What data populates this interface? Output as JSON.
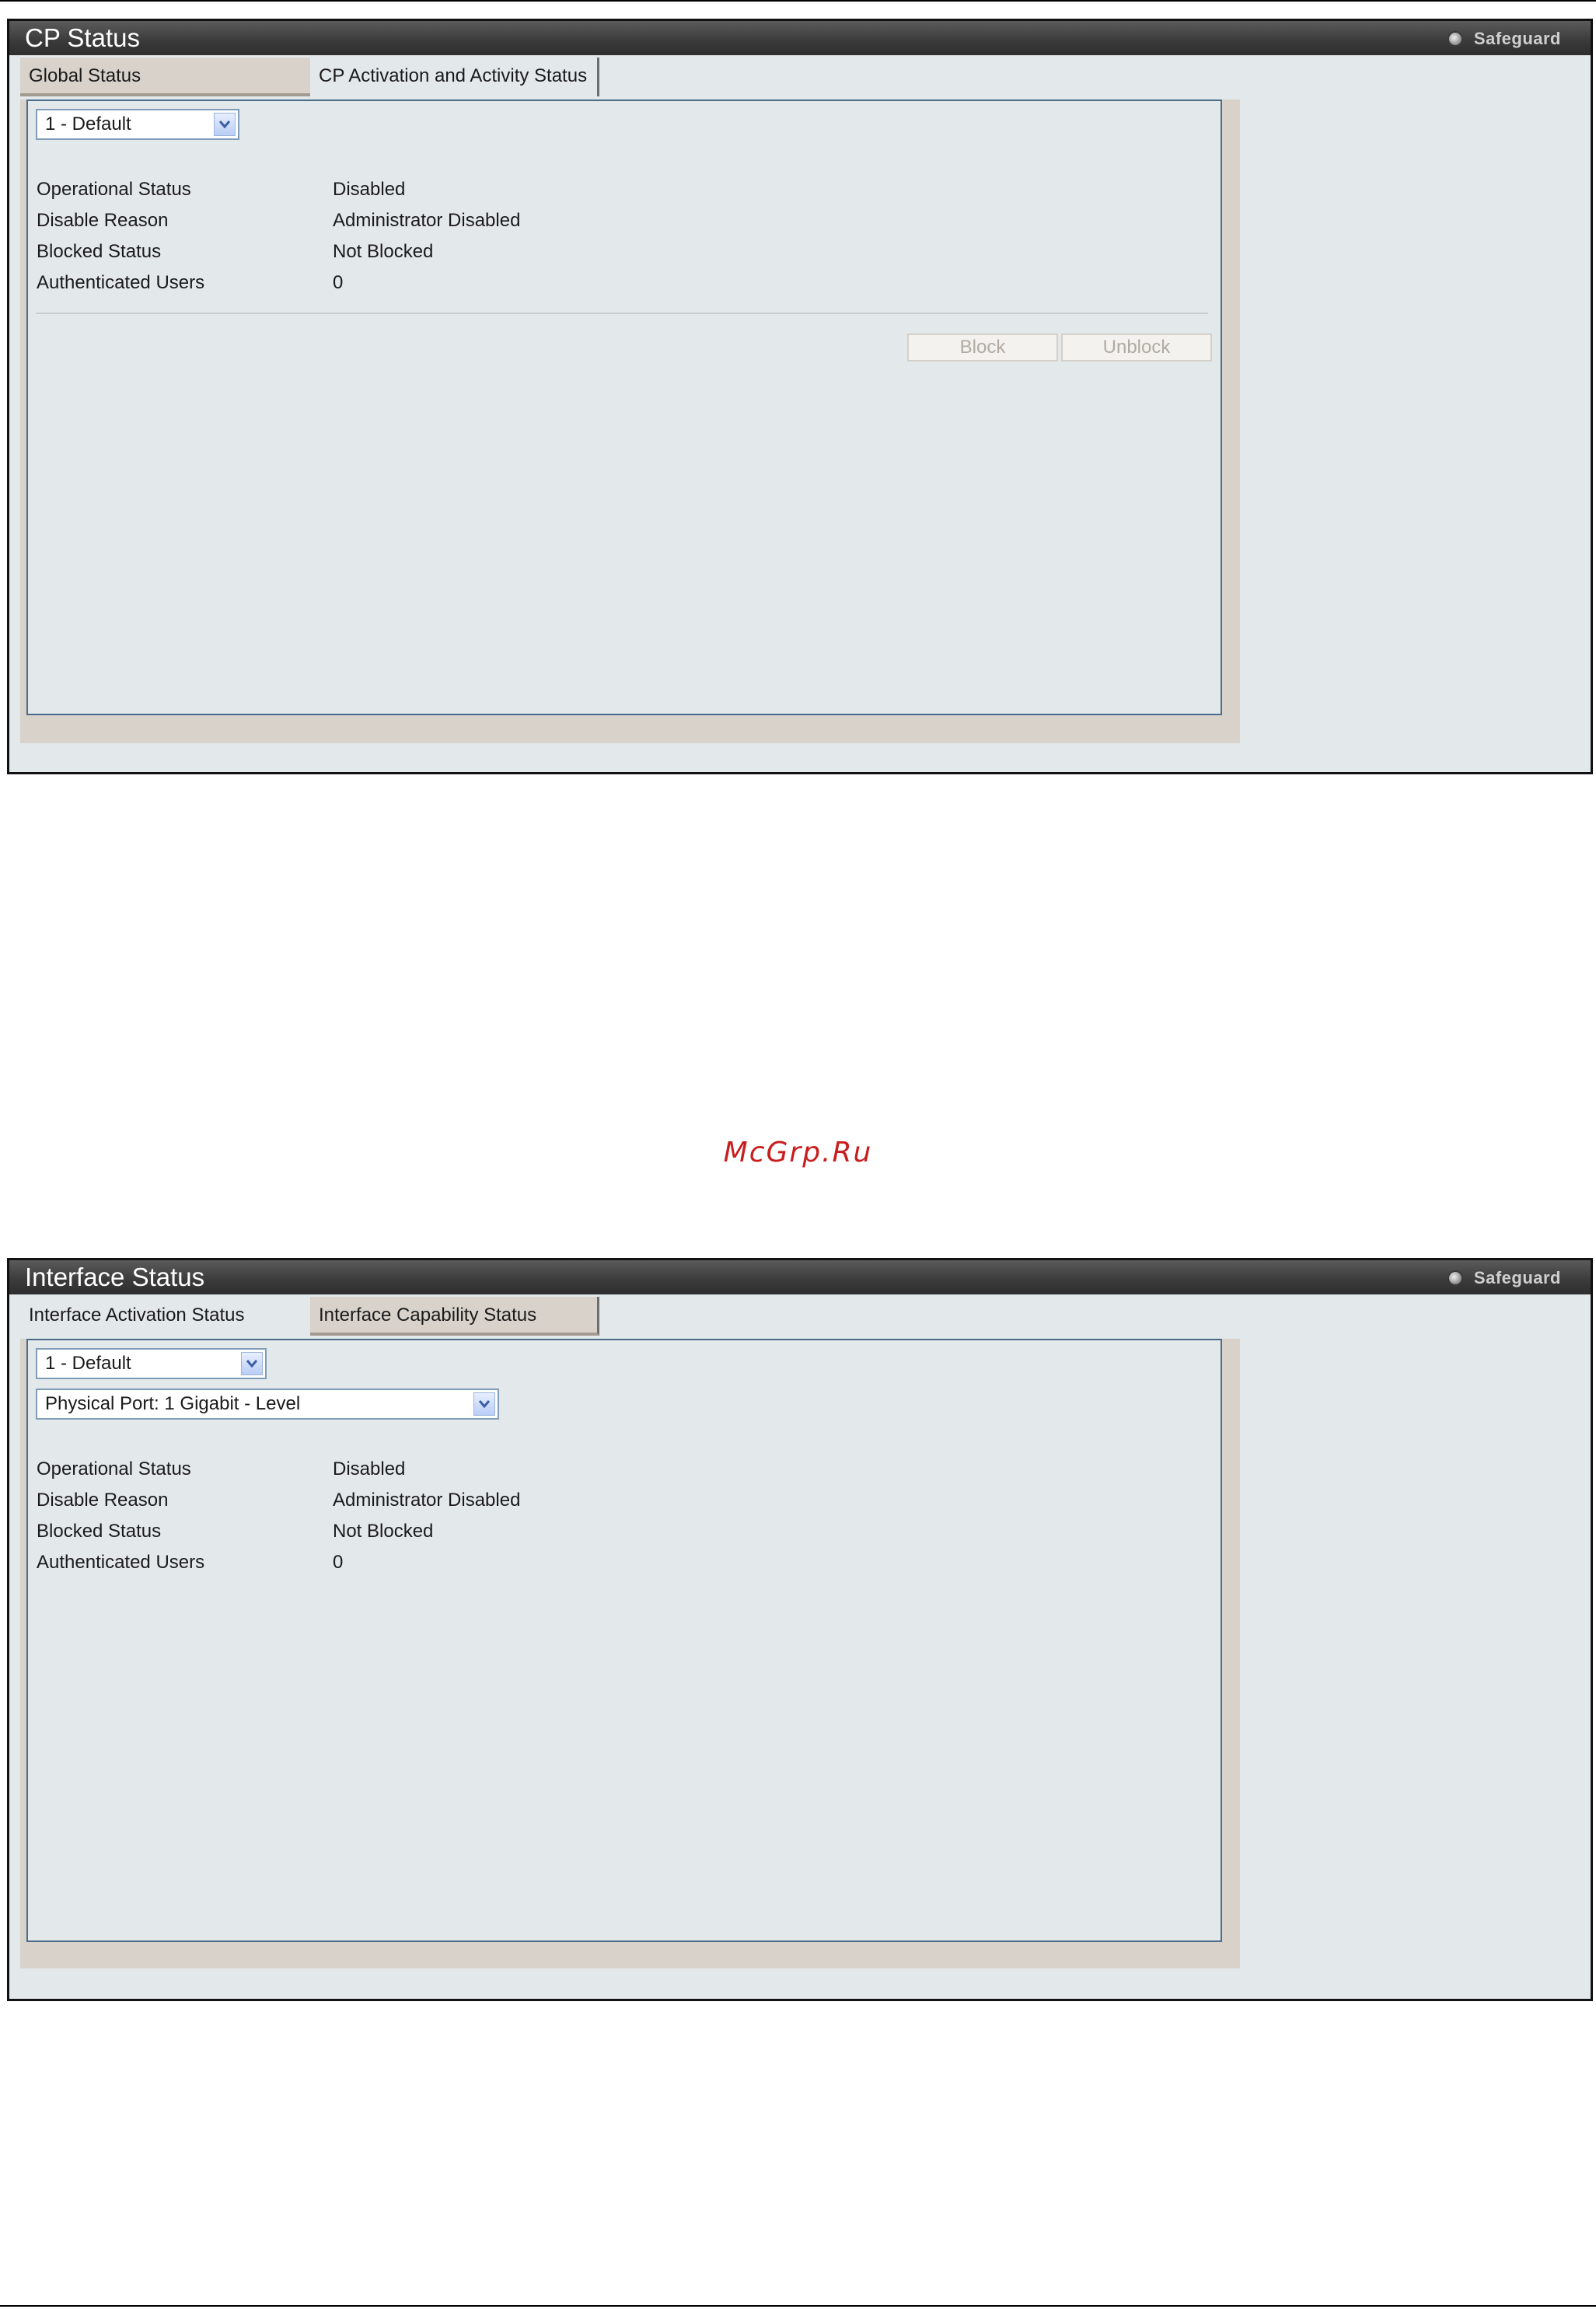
{
  "panel1": {
    "title": "CP Status",
    "safeguard": "Safeguard",
    "tabs": [
      {
        "label": "Global Status",
        "active": false
      },
      {
        "label": "CP Activation and Activity Status",
        "active": true
      }
    ],
    "select": {
      "value": "1 - Default"
    },
    "rows": [
      {
        "label": "Operational Status",
        "value": "Disabled"
      },
      {
        "label": "Disable Reason",
        "value": "Administrator Disabled"
      },
      {
        "label": "Blocked Status",
        "value": "Not Blocked"
      },
      {
        "label": "Authenticated Users",
        "value": "0"
      }
    ],
    "buttons": {
      "block": "Block",
      "unblock": "Unblock"
    }
  },
  "watermark": "McGrp.Ru",
  "panel2": {
    "title": "Interface Status",
    "safeguard": "Safeguard",
    "tabs": [
      {
        "label": "Interface Activation Status",
        "active": true
      },
      {
        "label": "Interface Capability Status",
        "active": false
      }
    ],
    "select_cp": {
      "value": "1 - Default"
    },
    "select_port": {
      "value": "Physical Port: 1 Gigabit - Level"
    },
    "rows": [
      {
        "label": "Operational Status",
        "value": "Disabled"
      },
      {
        "label": "Disable Reason",
        "value": "Administrator Disabled"
      },
      {
        "label": "Blocked Status",
        "value": "Not Blocked"
      },
      {
        "label": "Authenticated Users",
        "value": "0"
      }
    ]
  },
  "colors": {
    "titlebar": "#3a3a3a",
    "panel_bg": "#e3e8eb",
    "frame_border": "#4b6c8a",
    "watermark": "#c81e1e"
  },
  "icons": {
    "safeguard": "safeguard-icon",
    "dropdown": "chevron-down-icon"
  }
}
